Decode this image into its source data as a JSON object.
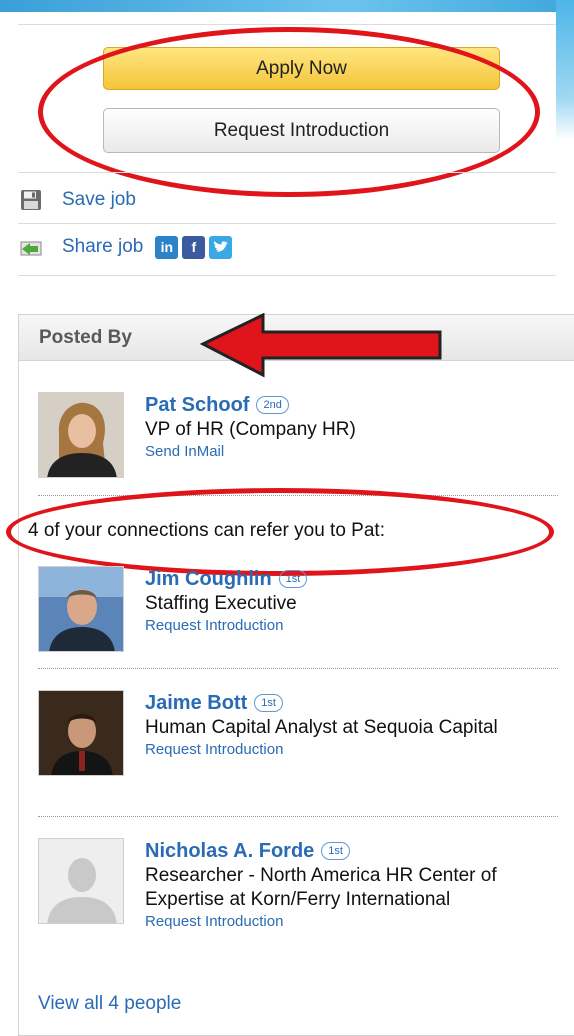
{
  "actions": {
    "apply_label": "Apply Now",
    "request_intro_label": "Request Introduction",
    "save_job": "Save job",
    "share_job": "Share job",
    "social": {
      "linkedin": "in",
      "facebook": "f",
      "twitter": "t"
    }
  },
  "posted_by": {
    "heading": "Posted By",
    "poster": {
      "name": "Pat Schoof",
      "degree": "2nd",
      "title": "VP of HR (Company HR)",
      "link": "Send InMail"
    },
    "connections_text": "4 of your connections can refer you to Pat:",
    "connections": [
      {
        "name": "Jim Coughlin",
        "degree": "1st",
        "title": "Staffing Executive",
        "link": "Request Introduction"
      },
      {
        "name": "Jaime Bott",
        "degree": "1st",
        "title": "Human Capital Analyst at Sequoia Capital",
        "link": "Request Introduction"
      },
      {
        "name": "Nicholas A. Forde",
        "degree": "1st",
        "title": "Researcher - North America HR Center of Expertise at Korn/Ferry International",
        "link": "Request Introduction"
      }
    ],
    "view_all": "View all 4 people"
  },
  "colors": {
    "link": "#2a6bb5",
    "annotation_red": "#e0141b",
    "apply_yellow": "#f4c53a"
  },
  "icons": {
    "save": "floppy-disk-icon",
    "share": "share-arrow-icon",
    "linkedin": "linkedin-icon",
    "facebook": "facebook-icon",
    "twitter": "twitter-icon",
    "default_avatar": "person-silhouette-icon"
  }
}
